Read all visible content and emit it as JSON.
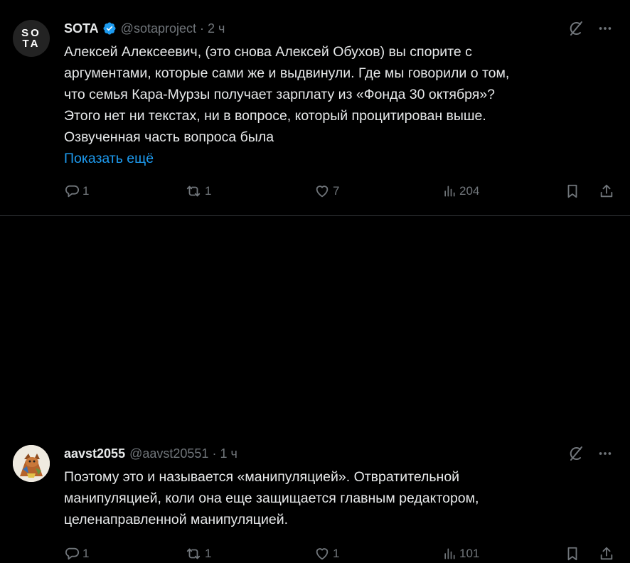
{
  "tweets": [
    {
      "avatar_text": [
        "SO",
        "TA"
      ],
      "name": "SOTA",
      "verified": true,
      "handle": "@sotaproject",
      "separator": "·",
      "time": "2 ч",
      "lines": [
        "Алексей Алексеевич, (это снова Алексей Обухов) вы спорите с",
        "аргументами, которые сами же и выдвинули. Где мы говорили о том,",
        "что семья Кара-Мурзы получает зарплату из «Фонда 30 октября»?",
        "Этого нет ни текстах, ни в вопросе, который процитирован выше.",
        "Озвученная часть вопроса была"
      ],
      "show_more": "Показать ещё",
      "replies": "1",
      "reposts": "1",
      "likes": "7",
      "views": "204"
    },
    {
      "avatar_icon": "fox-character-avatar",
      "name": "aavst2055",
      "handle": "@aavst20551",
      "separator": "·",
      "time": "1 ч",
      "lines": [
        "Поэтому это и называется «манипуляцией». Отвратительной",
        "манипуляцией, коли она еще защищается главным редактором,",
        "целенаправленной манипуляцией."
      ],
      "replies": "1",
      "reposts": "1",
      "likes": "1",
      "views": "101"
    }
  ],
  "colors": {
    "background": "#000000",
    "text": "#e7e9ea",
    "muted": "#71767b",
    "link": "#1d9bf0",
    "verified": "#1d9bf0",
    "divider": "#2f3336"
  }
}
